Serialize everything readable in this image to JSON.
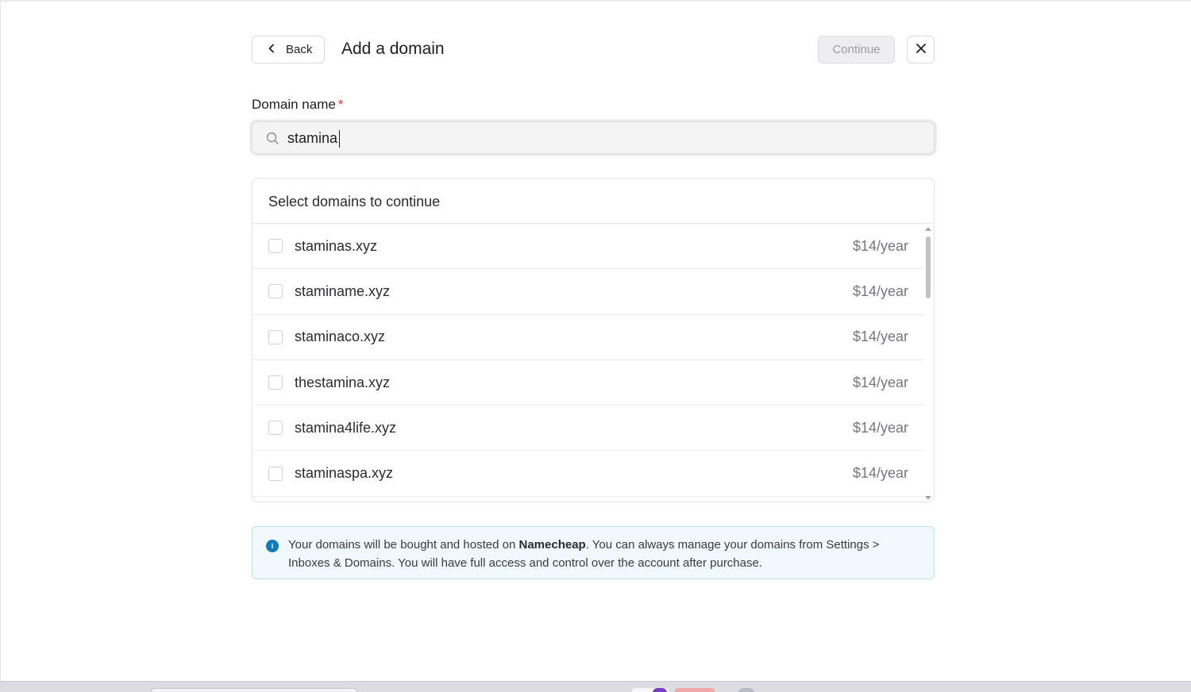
{
  "header": {
    "back_label": "Back",
    "title": "Add a domain",
    "continue_label": "Continue"
  },
  "form": {
    "field_label": "Domain name",
    "required_mark": "*",
    "search_value": "stamina"
  },
  "list": {
    "heading": "Select domains to continue",
    "items": [
      {
        "domain": "staminas.xyz",
        "price": "$14/year"
      },
      {
        "domain": "staminame.xyz",
        "price": "$14/year"
      },
      {
        "domain": "staminaco.xyz",
        "price": "$14/year"
      },
      {
        "domain": "thestamina.xyz",
        "price": "$14/year"
      },
      {
        "domain": "stamina4life.xyz",
        "price": "$14/year"
      },
      {
        "domain": "staminaspa.xyz",
        "price": "$14/year"
      }
    ]
  },
  "info": {
    "icon_text": "i",
    "text_before": "Your domains will be bought and hosted on ",
    "provider": "Namecheap",
    "text_after": ". You can always manage your domains from Settings > Inboxes & Domains. You will have full access and control over the account after purchase."
  },
  "colors": {
    "required": "#d9343b",
    "info_accent": "#1479b8",
    "info_background": "#f0f9fe"
  }
}
